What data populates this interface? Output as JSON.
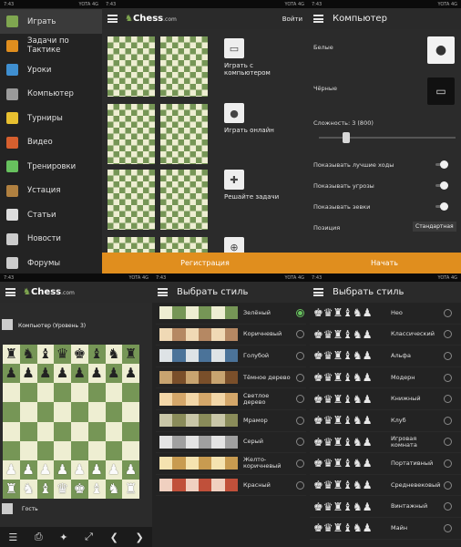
{
  "status": {
    "time": "7:43",
    "carrier": "YOTA 4G"
  },
  "p1": {
    "logo_a": "Chess",
    "logo_b": ".com",
    "menu": [
      {
        "label": "Играть",
        "color": "#7fa650"
      },
      {
        "label": "Задачи по Тактике",
        "color": "#e08e1e"
      },
      {
        "label": "Уроки",
        "color": "#3f8fd0"
      },
      {
        "label": "Компьютер",
        "color": "#9a9a9a"
      },
      {
        "label": "Турниры",
        "color": "#e8c030"
      },
      {
        "label": "Видео",
        "color": "#d65f2e"
      },
      {
        "label": "Тренировки",
        "color": "#67c15e"
      },
      {
        "label": "Устация",
        "color": "#b08040"
      },
      {
        "label": "Статьи",
        "color": "#dddddd"
      },
      {
        "label": "Новости",
        "color": "#cccccc"
      },
      {
        "label": "Форумы",
        "color": "#cccccc"
      }
    ]
  },
  "p2": {
    "logo_a": "Chess",
    "logo_b": ".com",
    "login": "Войти",
    "actions": [
      {
        "label": "Играть с компьютером",
        "icon": "computer-icon"
      },
      {
        "label": "Играть онлайн",
        "icon": "user-icon"
      },
      {
        "label": "Решайте задачи",
        "icon": "puzzle-icon"
      },
      {
        "label": "",
        "icon": "target-icon"
      }
    ],
    "register": "Регистрация"
  },
  "p3": {
    "title": "Компьютер",
    "white": "Белые",
    "black": "Чёрные",
    "difficulty": "Сложность: 3 (800)",
    "difficulty_value": 0.18,
    "toggles": [
      "Показывать лучшие ходы",
      "Показывать угрозы",
      "Показывать зевки"
    ],
    "position_label": "Позиция",
    "position_value": "Стандартная",
    "start": "Начать"
  },
  "p4": {
    "logo_a": "Chess",
    "logo_b": ".com",
    "opponent": "Компьютер (Уровень 3)",
    "player": "Гость",
    "ranks": [
      "8",
      "7",
      "6",
      "5",
      "4",
      "3",
      "2",
      "1"
    ]
  },
  "p5": {
    "title": "Выбрать стиль",
    "styles": [
      {
        "name": "Зелёный",
        "colors": [
          "#eeeed2",
          "#769656"
        ],
        "selected": true
      },
      {
        "name": "Коричневый",
        "colors": [
          "#f0d9b5",
          "#b58863"
        ],
        "selected": false
      },
      {
        "name": "Голубой",
        "colors": [
          "#dee3e6",
          "#4b7399"
        ],
        "selected": false
      },
      {
        "name": "Тёмное дерево",
        "colors": [
          "#c8a470",
          "#7a4f2a"
        ],
        "selected": false
      },
      {
        "name": "Светлое дерево",
        "colors": [
          "#f3d7a8",
          "#d4a76a"
        ],
        "selected": false
      },
      {
        "name": "Мрамор",
        "colors": [
          "#c9c7a8",
          "#8a8c5a"
        ],
        "selected": false
      },
      {
        "name": "Серый",
        "colors": [
          "#e4e4e4",
          "#a0a0a0"
        ],
        "selected": false
      },
      {
        "name": "Желто-коричневый",
        "colors": [
          "#f5e3b0",
          "#c89b50"
        ],
        "selected": false
      },
      {
        "name": "Красный",
        "colors": [
          "#f0d0c0",
          "#c0503a"
        ],
        "selected": false
      }
    ]
  },
  "p6": {
    "title": "Выбрать стиль",
    "sets": [
      {
        "name": "Нео",
        "glyphs": "♚♛♜♝♞♟"
      },
      {
        "name": "Классический",
        "glyphs": "♚♛♜♝♞♟"
      },
      {
        "name": "Альфа",
        "glyphs": "♚♛♜♝♞♟"
      },
      {
        "name": "Модерн",
        "glyphs": "♚♛♜♝♞♟"
      },
      {
        "name": "Книжный",
        "glyphs": "♚♛♜♝♞♟"
      },
      {
        "name": "Клуб",
        "glyphs": "♚♛♜♝♞♟"
      },
      {
        "name": "Игровая комната",
        "glyphs": "♚♛♜♝♞♟"
      },
      {
        "name": "Портативный",
        "glyphs": "♚♛♜♝♞♟"
      },
      {
        "name": "Средневековый",
        "glyphs": "♚♛♜♝♞♟"
      },
      {
        "name": "Винтажный",
        "glyphs": "♚♛♜♝♞♟"
      },
      {
        "name": "Майн",
        "glyphs": "♚♛♜♝♞♟"
      }
    ]
  }
}
